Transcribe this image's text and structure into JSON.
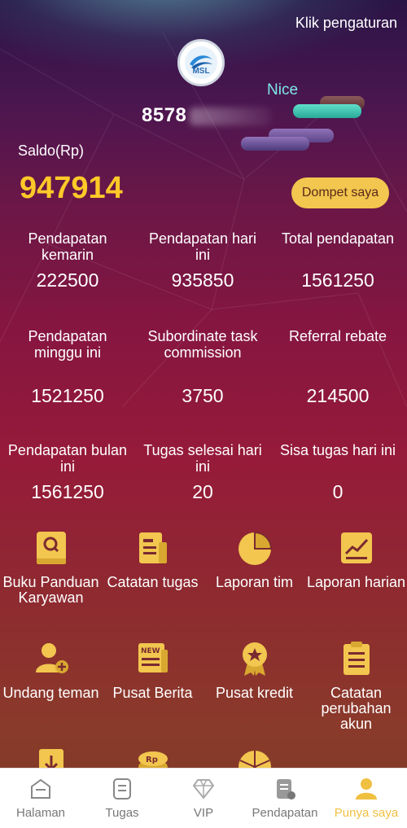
{
  "header": {
    "settings_label": "Klik pengaturan",
    "logo_text": "MSL",
    "phone_prefix": "8578",
    "badge_label": "Nice"
  },
  "balance": {
    "label": "Saldo(Rp)",
    "value": "947914",
    "wallet_button": "Dompet saya"
  },
  "stats": [
    {
      "label": "Pendapatan kemarin",
      "value": "222500"
    },
    {
      "label": "Pendapatan hari ini",
      "value": "935850"
    },
    {
      "label": "Total pendapatan",
      "value": "1561250"
    },
    {
      "label": "Pendapatan minggu ini",
      "value": "1521250"
    },
    {
      "label": "Subordinate task commission",
      "value": "3750"
    },
    {
      "label": "Referral rebate",
      "value": "214500"
    },
    {
      "label": "Pendapatan bulan ini",
      "value": "1561250"
    },
    {
      "label": "Tugas selesai hari ini",
      "value": "20"
    },
    {
      "label": "Sisa tugas hari ini",
      "value": "0"
    }
  ],
  "menu": [
    {
      "label": "Buku Panduan Karyawan",
      "icon": "book-icon"
    },
    {
      "label": "Catatan tugas",
      "icon": "notes-icon"
    },
    {
      "label": "Laporan tim",
      "icon": "pie-chart-icon"
    },
    {
      "label": "Laporan harian",
      "icon": "line-chart-icon"
    },
    {
      "label": "Undang teman",
      "icon": "add-user-icon"
    },
    {
      "label": "Pusat Berita",
      "icon": "news-icon"
    },
    {
      "label": "Pusat kredit",
      "icon": "medal-icon"
    },
    {
      "label": "Catatan perubahan akun",
      "icon": "clipboard-icon"
    }
  ],
  "tabs": [
    {
      "label": "Halaman",
      "icon": "home-icon"
    },
    {
      "label": "Tugas",
      "icon": "task-icon"
    },
    {
      "label": "VIP",
      "icon": "diamond-icon"
    },
    {
      "label": "Pendapatan",
      "icon": "income-icon"
    },
    {
      "label": "Punya saya",
      "icon": "profile-icon"
    }
  ],
  "colors": {
    "accent": "#ffc928",
    "button": "#f2c64f",
    "icon": "#f2c64f",
    "tab_active": "#f0c040"
  }
}
